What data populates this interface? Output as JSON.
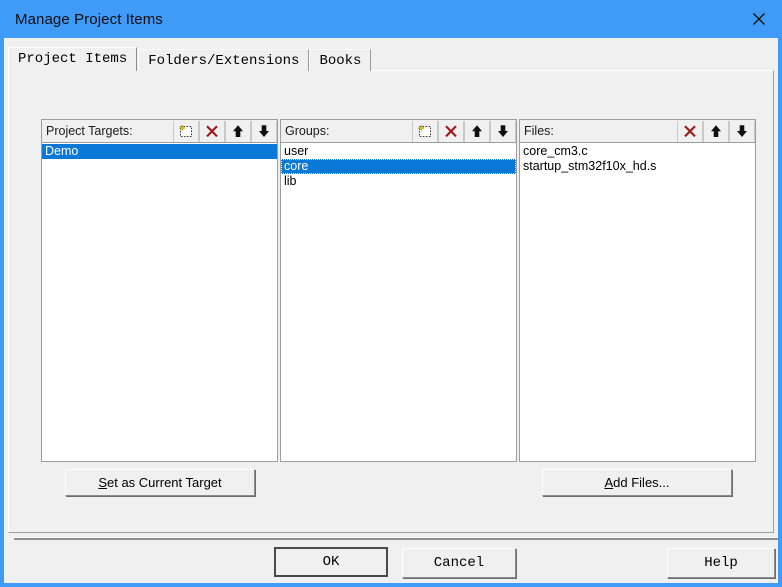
{
  "window": {
    "title": "Manage Project Items",
    "close_icon": "close-icon",
    "accent_color": "#3f9bf7",
    "background_color": "#f0f0f0"
  },
  "tabs": [
    {
      "label": "Project Items",
      "active": true
    },
    {
      "label": "Folders/Extensions",
      "active": false
    },
    {
      "label": "Books",
      "active": false
    }
  ],
  "panels": {
    "targets": {
      "header_label": "Project Targets:",
      "buttons": [
        {
          "name": "new-item-icon",
          "title": "New (Insert)"
        },
        {
          "name": "delete-icon",
          "title": "Remove Item"
        },
        {
          "name": "arrow-up-icon",
          "title": "Move Up"
        },
        {
          "name": "arrow-down-icon",
          "title": "Move Down"
        }
      ],
      "items": [
        {
          "label": "Demo",
          "selected": true,
          "focused": false
        }
      ]
    },
    "groups": {
      "header_label": "Groups:",
      "buttons": [
        {
          "name": "new-item-icon",
          "title": "New (Insert)"
        },
        {
          "name": "delete-icon",
          "title": "Remove Item"
        },
        {
          "name": "arrow-up-icon",
          "title": "Move Up"
        },
        {
          "name": "arrow-down-icon",
          "title": "Move Down"
        }
      ],
      "items": [
        {
          "label": "user",
          "selected": false,
          "focused": false
        },
        {
          "label": "core",
          "selected": true,
          "focused": true
        },
        {
          "label": "lib",
          "selected": false,
          "focused": false
        }
      ]
    },
    "files": {
      "header_label": "Files:",
      "buttons": [
        {
          "name": "delete-icon",
          "title": "Remove Item"
        },
        {
          "name": "arrow-up-icon",
          "title": "Move Up"
        },
        {
          "name": "arrow-down-icon",
          "title": "Move Down"
        }
      ],
      "items": [
        {
          "label": "core_cm3.c",
          "selected": false,
          "focused": false
        },
        {
          "label": "startup_stm32f10x_hd.s",
          "selected": false,
          "focused": false
        }
      ]
    }
  },
  "actions": {
    "set_current_target": {
      "accel": "S",
      "rest": "et as Current Target"
    },
    "add_files": {
      "accel": "A",
      "rest": "dd Files..."
    }
  },
  "dialog_buttons": {
    "ok": "OK",
    "cancel": "Cancel",
    "help": "Help"
  },
  "colors": {
    "selection": "#0a78d7",
    "selection_text": "#ffffff",
    "delete_icon": "#a01818",
    "title_bar": "#3f9bf7"
  }
}
